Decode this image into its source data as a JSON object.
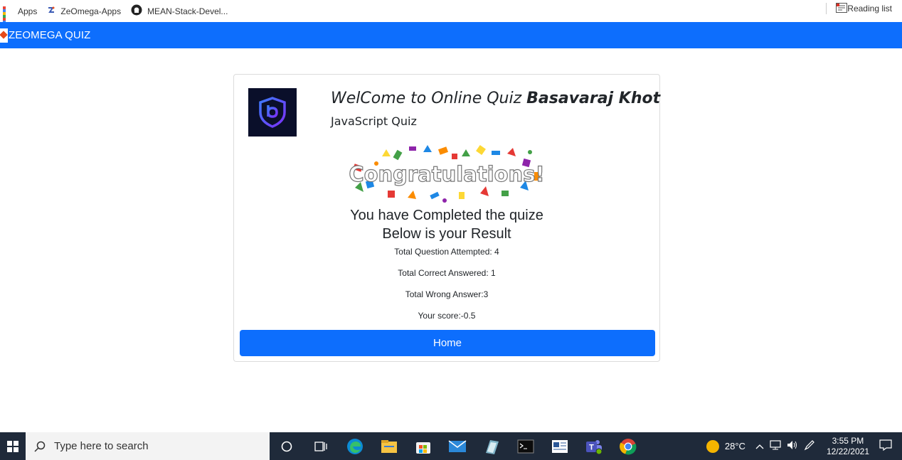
{
  "bookmarks": {
    "items": [
      {
        "label": "Apps",
        "icon": "apps-grid-icon"
      },
      {
        "label": "ZeOmega-Apps",
        "icon": "zeomega-icon"
      },
      {
        "label": "MEAN-Stack-Devel...",
        "icon": "github-icon"
      }
    ],
    "reading_list": "Reading list"
  },
  "navbar": {
    "brand": "ZEOMEGA QUIZ",
    "color": "#0d6efd"
  },
  "card": {
    "welcome_prefix": "WelCome to Online Quiz ",
    "user_name": "Basavaraj Khot",
    "quiz_name": "JavaScript Quiz",
    "congrats_text": "Congratulations!",
    "completed_text": "You have Completed the quize",
    "result_heading": "Below is your Result",
    "stats": {
      "attempted": "Total Question Attempted: 4",
      "correct": "Total Correct Answered: 1",
      "wrong": "Total Wrong Answer:3",
      "score": "Your score:-0.5"
    },
    "home_button": "Home"
  },
  "taskbar": {
    "search_placeholder": "Type here to search",
    "weather": "28°C",
    "time": "3:55 PM",
    "date": "12/22/2021",
    "pinned": [
      "task-view-icon",
      "edge-icon",
      "file-explorer-icon",
      "store-icon",
      "mail-icon",
      "notepad-icon",
      "terminal-icon",
      "news-icon",
      "teams-icon",
      "chrome-icon"
    ]
  }
}
